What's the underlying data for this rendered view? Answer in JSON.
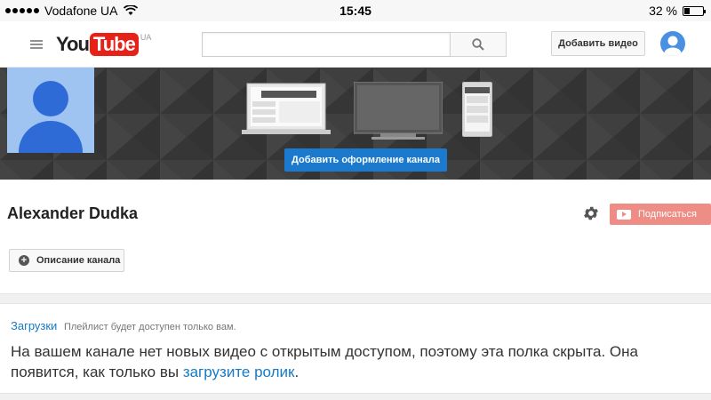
{
  "status_bar": {
    "carrier": "Vodafone UA",
    "time": "15:45",
    "battery_percent": "32 %",
    "battery_level": 0.32
  },
  "header": {
    "logo_you": "You",
    "logo_tube": "Tube",
    "logo_region": "UA",
    "search_placeholder": "",
    "upload_label": "Добавить видео",
    "icons": [
      "menu-icon",
      "search-icon",
      "user-avatar-icon"
    ]
  },
  "banner": {
    "add_art_label": "Добавить оформление канала",
    "devices": [
      "laptop-icon",
      "tv-icon",
      "phone-icon"
    ]
  },
  "channel": {
    "name": "Alexander Dudka",
    "subscribe_label": "Подписаться",
    "description_label": "Описание канала"
  },
  "shelf": {
    "title": "Загрузки",
    "note": "Плейлист будет доступен только вам.",
    "message_line1": "На вашем канале нет новых видео с открытым доступом, поэтому эта полка скрыта. Она",
    "message_line2_prefix": "появится, как только вы ",
    "message_link": "загрузите ролик",
    "message_suffix": "."
  },
  "colors": {
    "accent_blue": "#167ac6",
    "youtube_red": "#e62117",
    "subscribe_bg": "#ee8c86",
    "banner_bg": "#3b3b3b"
  }
}
